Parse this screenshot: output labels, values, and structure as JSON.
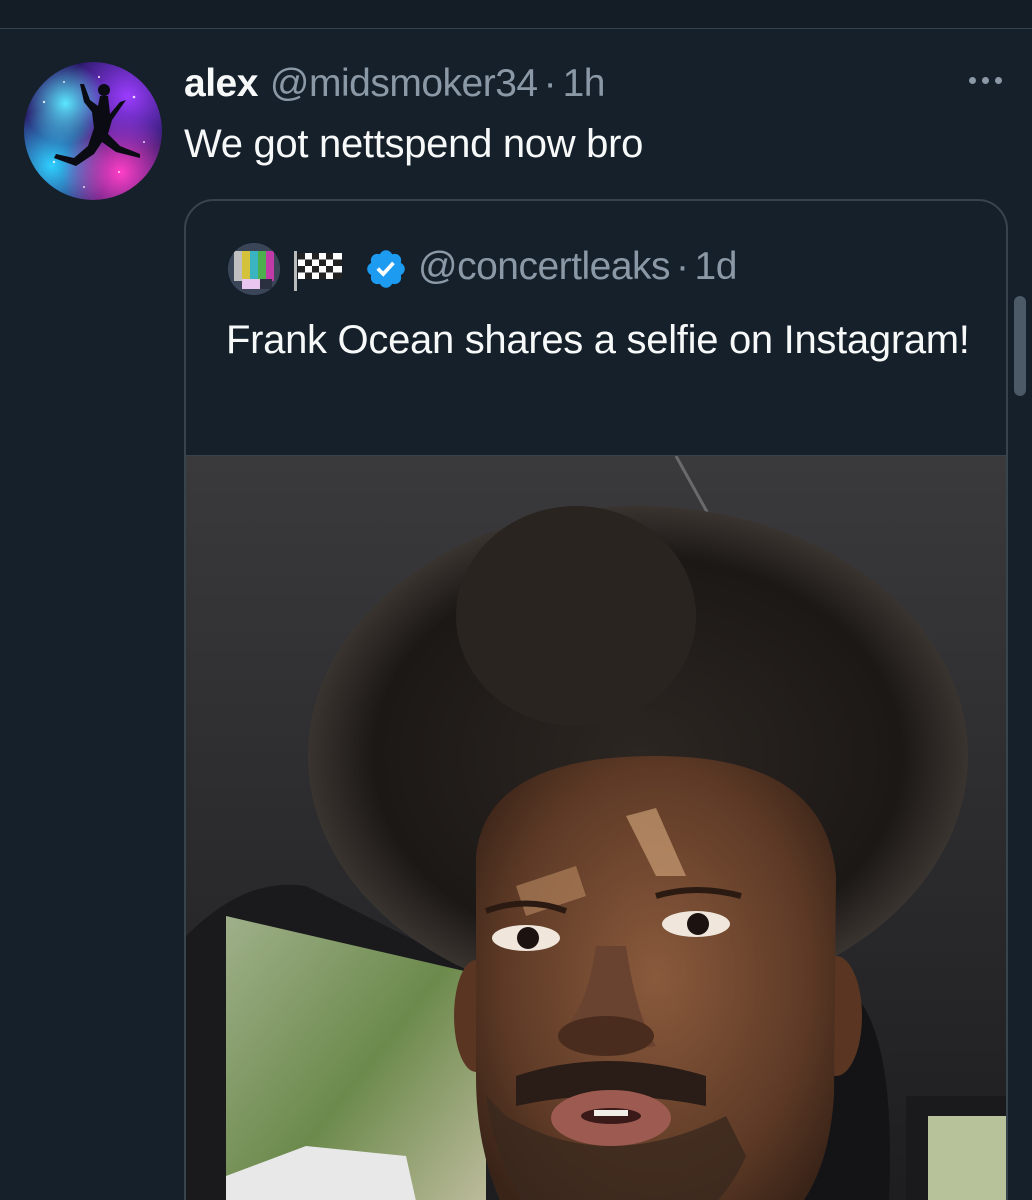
{
  "tweet": {
    "display_name": "alex",
    "handle": "@midsmoker34",
    "separator": "·",
    "time": "1h",
    "text": "We got nettspend now bro",
    "avatar_icon": "jumpman-galaxy-avatar",
    "more_icon": "more-dots-icon"
  },
  "quoted": {
    "handle": "@concertleaks",
    "separator": "·",
    "time": "1d",
    "text": "Frank Ocean shares a selfie on Instagram!",
    "avatar_icon": "glitch-avatar",
    "flag_icon": "checkered-flag-icon",
    "verified_icon": "verified-badge-icon",
    "verified_color": "#1d9bf0",
    "media_description_icon": "selfie-photo"
  },
  "theme": {
    "background": "#15202b",
    "border": "#38444d",
    "muted_text": "#8b98a5",
    "primary_text": "#f7f9f9"
  }
}
